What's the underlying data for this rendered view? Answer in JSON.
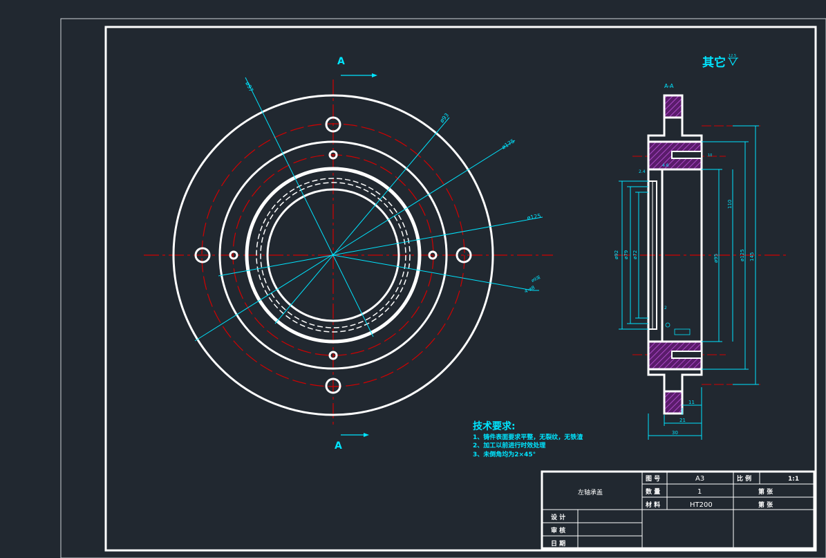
{
  "title_block": {
    "part_name": "左轴承盖",
    "drawing_no_label": "图 号",
    "drawing_no_value": "A3",
    "scale_label": "比 例",
    "scale_value": "1:1",
    "quantity_label": "数 量",
    "quantity_value": "1",
    "material_label": "材 料",
    "material_value": "HT200",
    "sheet_label_1": "第 张",
    "sheet_label_2": "第 张",
    "design_label": "设 计",
    "review_label": "审 核",
    "date_label": "日 期"
  },
  "section_marks": {
    "top": "A",
    "bottom": "A",
    "section_title": "A-A"
  },
  "surface_note": {
    "text": "其它",
    "roughness": "12.5"
  },
  "tech_requirements": {
    "title": "技术要求:",
    "lines": [
      "1、铸件表面要求平整，无裂纹，无铁渣",
      "2、加工以前进行时效处理",
      "3、未倒角均为2×45°"
    ]
  },
  "front_view_dims": [
    "ø97",
    "ø93",
    "ø175",
    "ø125",
    "4-ø8",
    "ø9深"
  ],
  "section_view_dims": {
    "vertical_left": [
      "ø92",
      "ø79",
      "ø72"
    ],
    "vertical_right": [
      "ø95",
      "ø125",
      "145",
      "110"
    ],
    "horizontal": [
      "30",
      "21",
      "11",
      "2.4",
      "4.6",
      "10",
      "2"
    ]
  },
  "colors": {
    "background": "#212830",
    "outline": "#ffffff",
    "dimension": "#00e5ff",
    "centerline": "#d40000",
    "hatch": "#9c2fb0",
    "hatch_dark": "#5a1c6b"
  }
}
